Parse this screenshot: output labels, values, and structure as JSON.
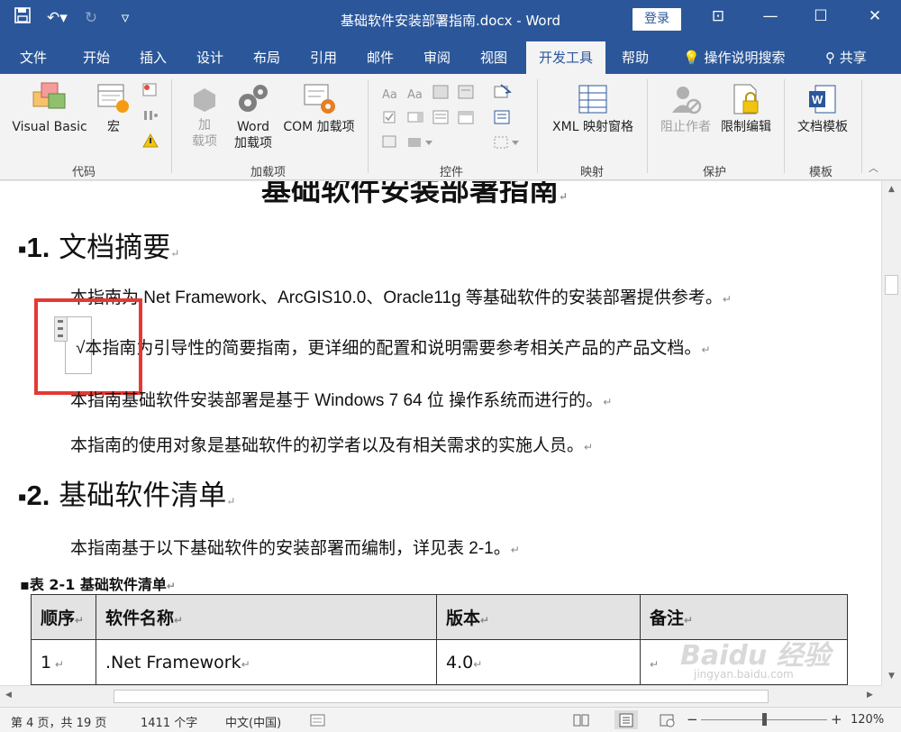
{
  "app": {
    "title": "基础软件安装部署指南.docx - Word",
    "login_label": "登录",
    "share_label": "共享",
    "search_label": "操作说明搜索"
  },
  "tabs": [
    {
      "label": "文件"
    },
    {
      "label": "开始"
    },
    {
      "label": "插入"
    },
    {
      "label": "设计"
    },
    {
      "label": "布局"
    },
    {
      "label": "引用"
    },
    {
      "label": "邮件"
    },
    {
      "label": "审阅"
    },
    {
      "label": "视图"
    },
    {
      "label": "开发工具",
      "active": true
    },
    {
      "label": "帮助"
    }
  ],
  "ribbon": {
    "code": {
      "label": "代码",
      "visual_basic": "Visual Basic",
      "macro": "宏"
    },
    "addins": {
      "label": "加载项",
      "add_line1": "加",
      "add_line2": "载项",
      "word_line1": "Word",
      "word_line2": "加载项",
      "com": "COM 加载项"
    },
    "controls": {
      "label": "控件"
    },
    "mapping": {
      "label": "映射",
      "xml": "XML 映射窗格"
    },
    "protect": {
      "label": "保护",
      "block_authors": "阻止作者",
      "restrict": "限制编辑"
    },
    "templates": {
      "label": "模板",
      "doc_template": "文档模板"
    }
  },
  "document": {
    "title_partial": "基础软件安装部署指南",
    "section1": {
      "number": "1.",
      "title": "文档摘要"
    },
    "p1": "本指南为.Net Framework、ArcGIS10.0、Oracle11g 等基础软件的安装部署提供参考。",
    "p2": "√本指南为引导性的简要指南，更详细的配置和说明需要参考相关产品的产品文档。",
    "p3": "本指南基础软件安装部署是基于  Windows 7 64 位  操作系统而进行的。",
    "p4": "本指南的使用对象是基础软件的初学者以及有相关需求的实施人员。",
    "section2": {
      "number": "2.",
      "title": "基础软件清单"
    },
    "p5": "本指南基于以下基础软件的安装部署而编制，详见表 2-1。",
    "table_caption": "表  2-1  基础软件清单",
    "table": {
      "headers": [
        "顺序",
        "软件名称",
        "版本",
        "备注"
      ],
      "rows": [
        [
          "1",
          ".Net Framework",
          "4.0",
          ""
        ]
      ]
    }
  },
  "status": {
    "page": "第 4 页，共 19 页",
    "words": "1411 个字",
    "lang": "中文(中国)",
    "zoom": "120%"
  },
  "watermark": {
    "main": "Baidu 经验",
    "sub": "jingyan.baidu.com"
  }
}
